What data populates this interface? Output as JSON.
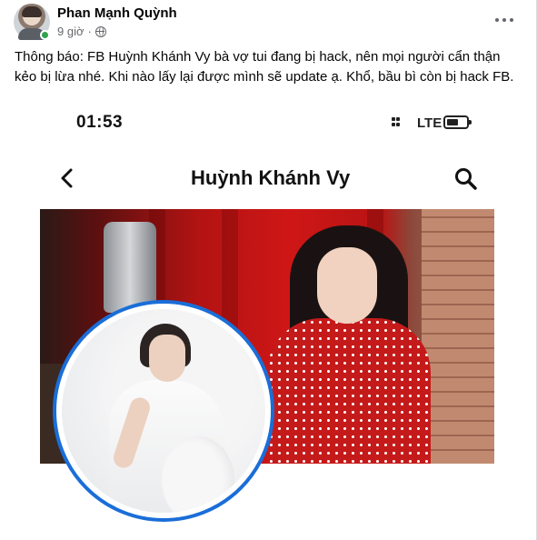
{
  "post": {
    "author": "Phan Mạnh Quỳnh",
    "time": "9 giờ",
    "separator": "·",
    "caption": "Thông báo: FB Huỳnh Khánh Vy bà vợ tui đang bị hack, nên mọi người cẩn thận kẻo bị lừa nhé. Khi nào lấy lại được mình sẽ update ạ. Khổ, bầu bì còn bị hack FB."
  },
  "screenshot": {
    "status_time": "01:53",
    "network": "LTE",
    "profile_name": "Huỳnh Khánh Vy"
  },
  "colors": {
    "online": "#31a24c",
    "avatar_ring": "#1a6ed8",
    "cover_red": "#cf1616"
  },
  "icons": {
    "privacy": "globe-icon",
    "options": "more-options-icon",
    "back": "chevron-left-icon",
    "search": "search-icon",
    "signal": "signal-icon",
    "battery": "battery-icon"
  }
}
